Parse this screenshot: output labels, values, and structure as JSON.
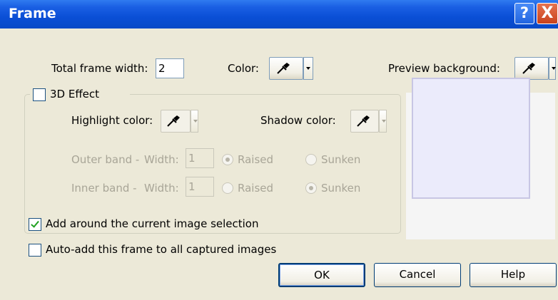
{
  "window": {
    "title": "Frame",
    "help_symbol": "?",
    "close_symbol": "X"
  },
  "frame_width": {
    "label": "Total frame width:",
    "value": "2"
  },
  "color": {
    "label": "Color:"
  },
  "preview_background": {
    "label": "Preview background:"
  },
  "effect3d": {
    "label": "3D Effect",
    "checked": false
  },
  "highlight": {
    "label": "Highlight color:"
  },
  "shadow": {
    "label": "Shadow color:"
  },
  "outer_band": {
    "label": "Outer band -",
    "width_label": "Width:",
    "width_value": "1",
    "raised": "Raised",
    "sunken": "Sunken",
    "selected": "Raised"
  },
  "inner_band": {
    "label": "Inner band -",
    "width_label": "Width:",
    "width_value": "1",
    "raised": "Raised",
    "sunken": "Sunken",
    "selected": "Sunken"
  },
  "options": {
    "add_around": {
      "label": "Add around the current image selection",
      "checked": true
    },
    "auto_add": {
      "label": "Auto-add this frame to all captured images",
      "checked": false
    }
  },
  "buttons": {
    "ok": "OK",
    "cancel": "Cancel",
    "help": "Help"
  },
  "icons": {
    "eyedropper": "eyedropper-icon",
    "dropdown": "dropdown-arrow-icon"
  }
}
